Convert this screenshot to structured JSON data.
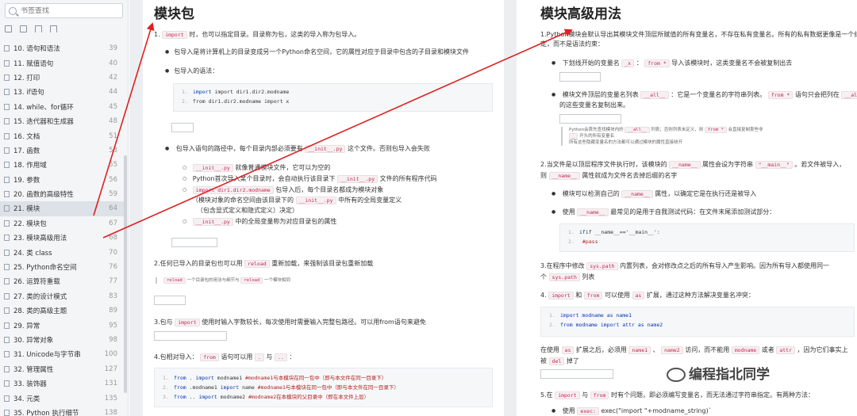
{
  "sidebar": {
    "search_placeholder": "书签查找",
    "items": [
      {
        "label": "10. 语句和语法",
        "page": "39"
      },
      {
        "label": "11. 赋值语句",
        "page": "40"
      },
      {
        "label": "12. 打印",
        "page": "42"
      },
      {
        "label": "13. if语句",
        "page": "44"
      },
      {
        "label": "14. while、for循环",
        "page": "45"
      },
      {
        "label": "15. 迭代器和生成器",
        "page": "48"
      },
      {
        "label": "16. 文档",
        "page": "51"
      },
      {
        "label": "17. 函数",
        "page": "53"
      },
      {
        "label": "18. 作用域",
        "page": "55"
      },
      {
        "label": "19. 参数",
        "page": "56"
      },
      {
        "label": "20. 函数的高级特性",
        "page": "59"
      },
      {
        "label": "21. 模块",
        "page": "64"
      },
      {
        "label": "22. 模块包",
        "page": "67"
      },
      {
        "label": "23. 模块高级用法",
        "page": "68"
      },
      {
        "label": "24. 类 class",
        "page": "70"
      },
      {
        "label": "25. Python命名空间",
        "page": "76"
      },
      {
        "label": "26. 运算符重载",
        "page": "77"
      },
      {
        "label": "27. 类的设计模式",
        "page": "83"
      },
      {
        "label": "28. 类的高级主题",
        "page": "89"
      },
      {
        "label": "29. 异常",
        "page": "95"
      },
      {
        "label": "30. 异常对象",
        "page": "98"
      },
      {
        "label": "31. Unicode与字节串",
        "page": "100"
      },
      {
        "label": "32. 管理属性",
        "page": "127"
      },
      {
        "label": "33. 装饰器",
        "page": "131"
      },
      {
        "label": "34. 元类",
        "page": "135"
      },
      {
        "label": "35. Python 执行细节",
        "page": "138"
      }
    ]
  },
  "left_page": {
    "title": "模块包",
    "l1": {
      "num": "1.",
      "code": "import",
      "text": "时，也可以指定目录。目录称为包，这类的导入称为包导入。"
    },
    "b1": "包导入是将计算机上的目录变成另一个Python命名空间，它的属性对应于目录中包含的子目录和模块文件",
    "b2": "包导入的语法：",
    "code1": [
      "import dir1.dir2.modname",
      "from dir1.dir2.modname import x"
    ],
    "b3_pre": "包导入语句的路径中，每个目录内部必须要有",
    "b3_code": "__init__.py",
    "b3_post": "这个文件。否则包导入会失败",
    "s1_code": "__init__.py",
    "s1_text": "就像普通模块文件，它可以为空的",
    "s2_pre": "Python首次导入某个目录时，会自动执行该目录下",
    "s2_code": "__init__.py",
    "s2_post": "文件的所有程序代码",
    "s3_code": "import dir1.dir2.modname",
    "s3_text": "包导入后，每个目录名都成为模块对象",
    "s3_line2_pre": "（模块对象的命名空间由该目录下的",
    "s3_line2_code": "__init__.py",
    "s3_line2_post": "中所有的全局变量定义",
    "s3_line3": "（包含显式定义和隐式定义）决定）",
    "s4_code": "__init__.py",
    "s4_text": "中的全局变量称为对应目录包的属性",
    "l2_pre": "2.任何已导入的目录包也可以用",
    "l2_code": "reload",
    "l2_post": "重新加载，来强制该目录包重新加载",
    "note2_code1": "reload",
    "note2_mid": "一个目录包的用法与细节与",
    "note2_code2": "reload",
    "note2_end": "一个模块相同",
    "l3_pre": "3.包与",
    "l3_code": "import",
    "l3_post": "使用时输入字数较长，每次使用时需要输入完整包路径。可以用from语句来避免",
    "l4_pre": "4.包相对导入：",
    "l4_code1": "from",
    "l4_mid": "语句可以用",
    "l4_code2": ".",
    "l4_and": "与",
    "l4_code3": "..",
    "l4_colon": "：",
    "code4": [
      {
        "kw1": "from",
        "mod": " . ",
        "kw2": "import",
        "rest": " modname1 ",
        "cm": "#modname1与本模块在同一包中（即与本文件在同一目录下）"
      },
      {
        "kw1": "from",
        "mod": " .modname1 ",
        "kw2": "import",
        "rest": " name ",
        "cm": "#modname1与本模块在同一包中（即与本文件在同一目录下）"
      },
      {
        "kw1": "from",
        "mod": " .. ",
        "kw2": "import",
        "rest": " modname2 ",
        "cm": "#modname2在本模块的父目录中（即在本文件上层）"
      }
    ]
  },
  "right_page": {
    "title": "模块高级用法",
    "r1": "1.Python模块会默认导出其模块文件顶层所赋值的所有变量名，不存在私有变量名。所有的私有数据更像是一个约",
    "r1b": "定，而不是语法约束：",
    "rb1_pre": "下划线开始的变量名",
    "rb1_code1": "_x",
    "rb1_mid": "：",
    "rb1_code2": "from *",
    "rb1_post": "导入该模块时，这类变量名不会被复制出去",
    "rb2_pre": "模块文件顶层的变量名列表",
    "rb2_code1": "__all__",
    "rb2_mid": "：它是一个变量名的字符串列表。",
    "rb2_code2": "from *",
    "rb2_post": "语句只会把列在",
    "rb2_code3": "__all__",
    "rb2_line2": "的这些变量名复制出来。",
    "rnote_a": "Python会首先查找模块内的",
    "rnote_code1": "__all__",
    "rnote_b": "列表；否则列表未定义，则",
    "rnote_code2": "from *",
    "rnote_c": "会直接复制那些非",
    "rnote_code3": "_",
    "rnote_d": "开头的所有变量名",
    "rnote_line3": "所有这些隐藏变量名的方法都可以通过模块的属性直接绕开",
    "r2_pre": "2.当文件是以顶层程序文件执行时，该模块的",
    "r2_code1": "__name__",
    "r2_mid": "属性会设为字符串",
    "r2_code2": "\"__main__\"",
    "r2_post": "。若文件被导入，",
    "r2b_pre": "则",
    "r2b_code": "__name__",
    "r2b_post": "属性就成为文件名去掉后缀的名字",
    "rb3_pre": "模块可以检测自己的",
    "rb3_code": "__name__",
    "rb3_post": "属性，以确定它是在执行还是被导入",
    "rb4_pre": "使用",
    "rb4_code": "__name__",
    "rb4_post": "最常见的是用于自我测试代码：在文件末尾添加测试部分：",
    "code2": [
      "if __name__=='__main__':",
      "    #pass"
    ],
    "r3_pre": "3.在程序中修改",
    "r3_code": "sys.path",
    "r3_post": "内置列表，会对修改点之后的所有导入产生影响。因为所有导入都使用同一",
    "r3b_pre": "个",
    "r3b_code": "sys.path",
    "r3b_post": "列表",
    "r4_pre": "4.",
    "r4_code1": "import",
    "r4_and": "和",
    "r4_code2": "from",
    "r4_mid": "可以使用",
    "r4_code3": "as",
    "r4_post": "扩展，通过这种方法解决变量名冲突：",
    "code3": [
      "import modname as name1",
      "from modname import attr as name2"
    ],
    "r4c_pre": "在使用",
    "r4c_code1": "as",
    "r4c_mid1": "扩展之后，必须用",
    "r4c_code2": "name1",
    "r4c_sep": "、",
    "r4c_code3": "name2",
    "r4c_mid2": "访问，而不能用",
    "r4c_code4": "modname",
    "r4c_or": "或者",
    "r4c_code5": "attr",
    "r4c_post": "，因为它们事实上",
    "r4d_pre": "被",
    "r4d_code": "del",
    "r4d_post": "掉了",
    "r5_pre": "5.在",
    "r5_code1": "import",
    "r5_and": "与",
    "r5_code2": "from",
    "r5_post": "时有个问题，即必须编写变量名，而无法通过字符串指定。有两种方法：",
    "rb5_pre": "使用",
    "rb5_code": "exec:",
    "rb5_post": "exec(\"import \"+modname_string)`"
  },
  "watermark": "编程指北同学",
  "colors": {
    "arrow": "#e02020",
    "code_text": "#c7254e",
    "keyword": "#0033b3",
    "comment": "#b22222"
  }
}
